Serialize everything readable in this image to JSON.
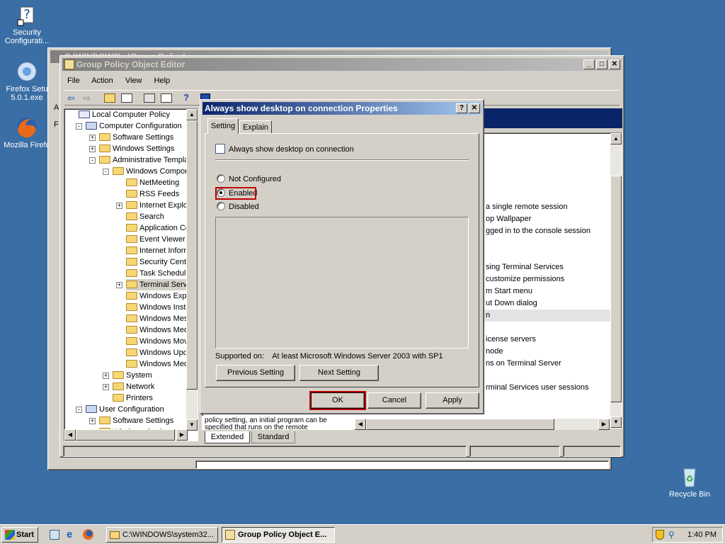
{
  "desktop": {
    "icons": [
      {
        "label": "Security Configurati..."
      },
      {
        "label": "Firefox Setu 5.0.1.exe"
      },
      {
        "label": "Mozilla Firefo"
      },
      {
        "label": "Recycle Bin"
      }
    ]
  },
  "back_window": {
    "title": "C:\\WINDOWS\\...\\Group Policy\\...",
    "left_chars": [
      "A",
      "F"
    ]
  },
  "gpedit": {
    "title": "Group Policy Object Editor",
    "menu": [
      "File",
      "Action",
      "View",
      "Help"
    ],
    "tree": [
      {
        "label": "Local Computer Policy",
        "level": 0
      },
      {
        "label": "Computer Configuration",
        "level": 1
      },
      {
        "label": "Software Settings",
        "level": 2
      },
      {
        "label": "Windows Settings",
        "level": 2
      },
      {
        "label": "Administrative Templates",
        "level": 2
      },
      {
        "label": "Windows Components",
        "level": 3
      },
      {
        "label": "NetMeeting",
        "level": 4
      },
      {
        "label": "RSS Feeds",
        "level": 4
      },
      {
        "label": "Internet Explorer",
        "level": 4
      },
      {
        "label": "Search",
        "level": 4
      },
      {
        "label": "Application Compatibility",
        "level": 4
      },
      {
        "label": "Event Viewer",
        "level": 4
      },
      {
        "label": "Internet Information Services",
        "level": 4
      },
      {
        "label": "Security Center",
        "level": 4
      },
      {
        "label": "Task Scheduler",
        "level": 4
      },
      {
        "label": "Terminal Services",
        "level": 4
      },
      {
        "label": "Windows Explorer",
        "level": 4
      },
      {
        "label": "Windows Installer",
        "level": 4
      },
      {
        "label": "Windows Messenger",
        "level": 4
      },
      {
        "label": "Windows Media Digital Rights Management",
        "level": 4
      },
      {
        "label": "Windows Movie Maker",
        "level": 4
      },
      {
        "label": "Windows Update",
        "level": 4
      },
      {
        "label": "Windows Media Player",
        "level": 4
      },
      {
        "label": "System",
        "level": 3
      },
      {
        "label": "Network",
        "level": 3
      },
      {
        "label": "Printers",
        "level": 3
      },
      {
        "label": "User Configuration",
        "level": 1
      },
      {
        "label": "Software Settings",
        "level": 2
      },
      {
        "label": "Windows Settings",
        "level": 2
      }
    ],
    "right_list": [
      "a single remote session",
      "op Wallpaper",
      "gged in to the console session",
      "",
      "",
      "sing Terminal Services",
      "customize permissions",
      "m Start menu",
      "ut Down dialog",
      "n",
      "",
      "icense servers",
      "node",
      "ns on Terminal Server",
      "",
      "rminal Services user sessions"
    ],
    "description_text": "policy setting, an initial program can be specified that runs on the remote",
    "tabs": [
      "Extended",
      "Standard"
    ]
  },
  "dialog": {
    "title": "Always show desktop on connection Properties",
    "tabs": [
      "Setting",
      "Explain"
    ],
    "setting_name": "Always show desktop on connection",
    "options": [
      "Not Configured",
      "Enabled",
      "Disabled"
    ],
    "selected": "Enabled",
    "supported_label": "Supported on:",
    "supported_value": "At least Microsoft Windows Server 2003 with SP1",
    "prev_button": "Previous Setting",
    "next_button": "Next Setting",
    "ok": "OK",
    "cancel": "Cancel",
    "apply": "Apply",
    "highlight_color": "#c00000"
  },
  "taskbar": {
    "start": "Start",
    "tasks": [
      {
        "label": "C:\\WINDOWS\\system32..."
      },
      {
        "label": "Group Policy Object E..."
      }
    ],
    "clock": "1:40 PM"
  }
}
